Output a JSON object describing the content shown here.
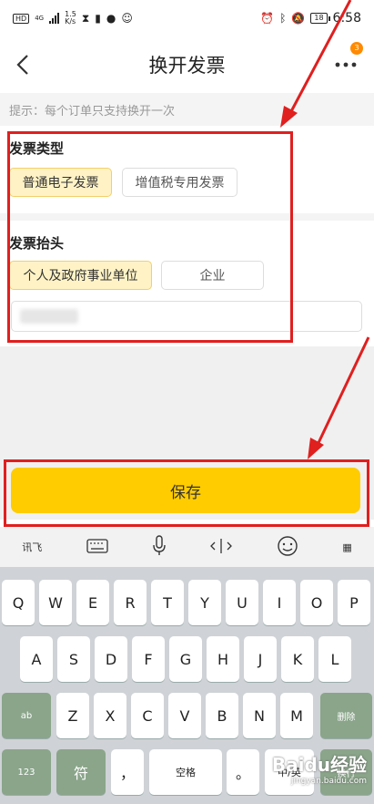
{
  "status_bar": {
    "hd": "HD",
    "net_type": "4G",
    "speed_value": "1.5",
    "speed_unit": "K/s",
    "battery": "18",
    "time": "6:58"
  },
  "nav": {
    "title": "换开发票",
    "notification_count": "3"
  },
  "hint": "提示：每个订单只支持换开一次",
  "invoice_type": {
    "title": "发票类型",
    "options": [
      "普通电子发票",
      "增值税专用发票"
    ],
    "selected": "普通电子发票"
  },
  "invoice_header": {
    "title": "发票抬头",
    "options": [
      "个人及政府事业单位",
      "企业"
    ],
    "selected": "个人及政府事业单位"
  },
  "save_label": "保存",
  "keyboard": {
    "toolbar": [
      "讯飞",
      "keyboard-icon",
      "microphone-icon",
      "cursor-icon",
      "emoji-icon",
      "trad-toggle"
    ],
    "row1": [
      "Q",
      "W",
      "E",
      "R",
      "T",
      "Y",
      "U",
      "I",
      "O",
      "P"
    ],
    "row2": [
      "A",
      "S",
      "D",
      "F",
      "G",
      "H",
      "J",
      "K",
      "L"
    ],
    "row3": [
      "Z",
      "X",
      "C",
      "V",
      "B",
      "N",
      "M"
    ],
    "shift": "ab",
    "delete": "删除",
    "num": "123",
    "symbol": "符",
    "comma": "，",
    "space": "空格",
    "period": "。",
    "switch": "中/英",
    "enter": "换行"
  },
  "colors": {
    "accent": "#ffcc00",
    "selected_chip": "#fff3c6",
    "annotation": "#e01f1f"
  },
  "watermark": {
    "logo": "Baidu经验",
    "url": "jingyan.baidu.com"
  }
}
